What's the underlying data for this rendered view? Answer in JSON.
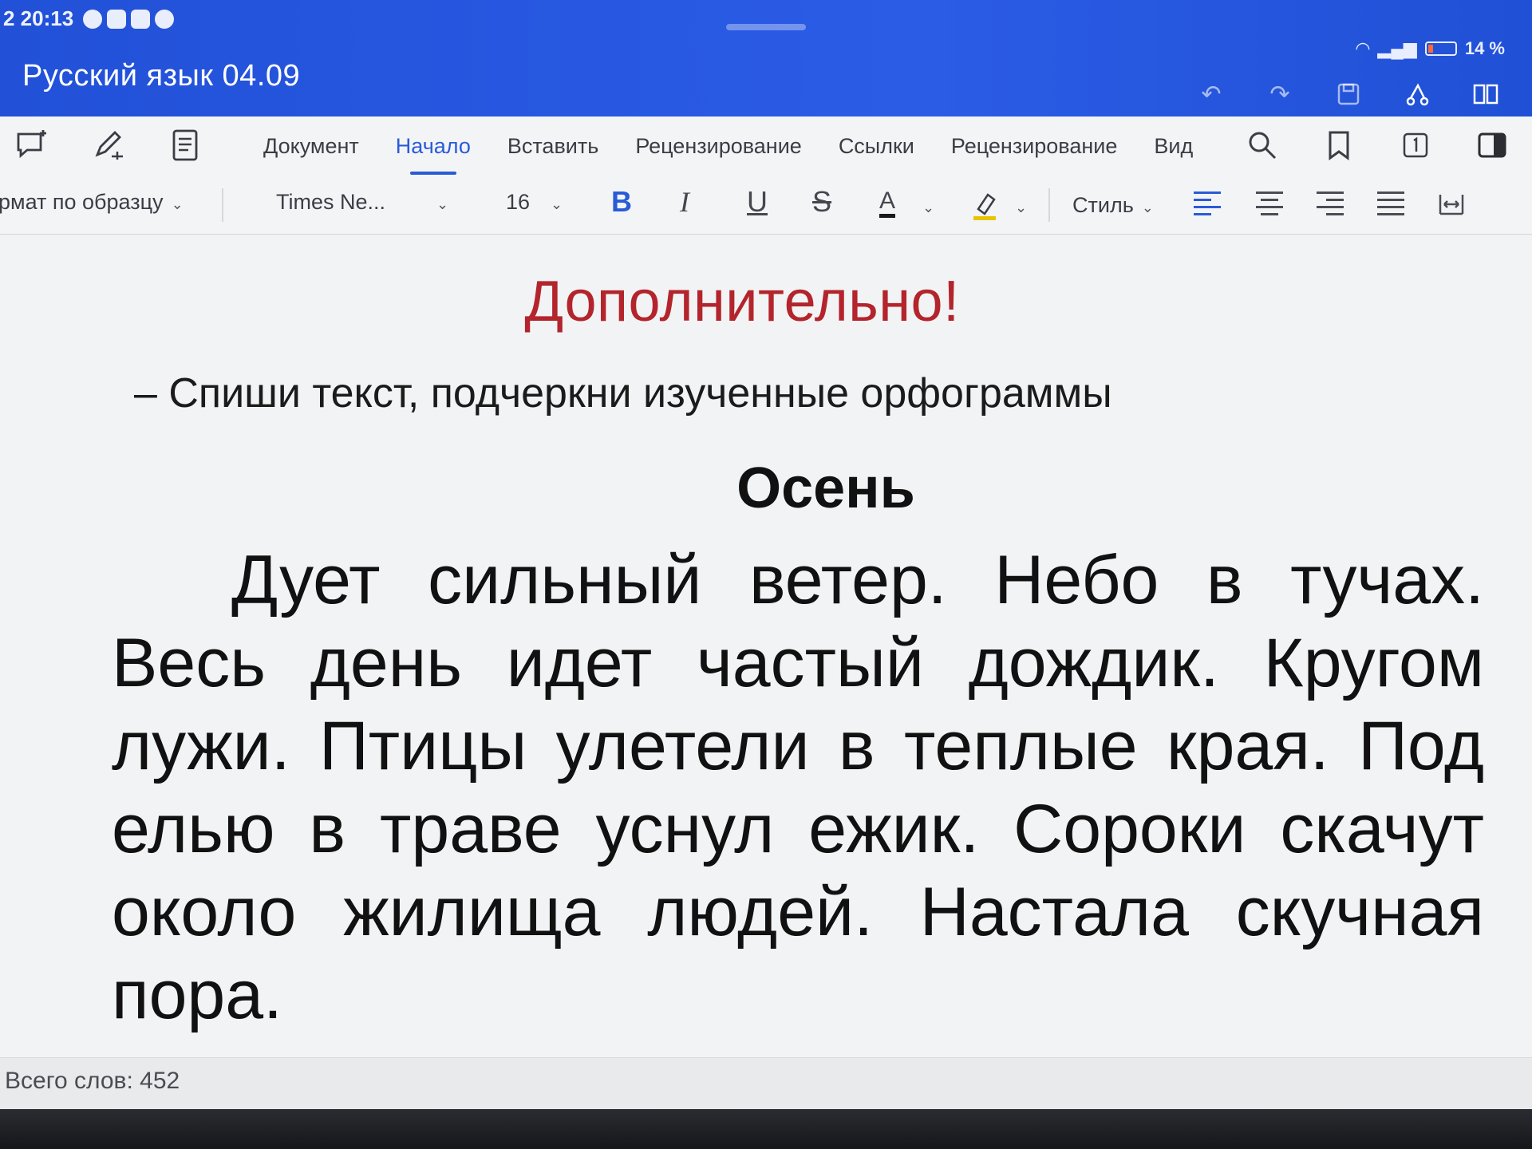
{
  "status": {
    "time": "2 20:13",
    "battery": "14 %"
  },
  "document": {
    "title": "Русский язык 04.09"
  },
  "ribbon": {
    "tabs": [
      "Документ",
      "Начало",
      "Вставить",
      "Рецензирование",
      "Ссылки",
      "Рецензирование",
      "Вид"
    ],
    "active_tab": "Начало",
    "format_painter": "рмат по образцу",
    "font_name": "Times Ne...",
    "font_size": "16",
    "bold": "B",
    "italic": "I",
    "underline": "U",
    "strike": "S",
    "font_color_letter": "A",
    "style_label": "Стиль"
  },
  "content": {
    "red_heading": "Дополнительно!",
    "instruction": "– Спиши текст, подчеркни изученные орфограммы",
    "heading": "Осень",
    "paragraph": "Дует сильный ветер. Небо в тучах. Весь день идет частый дождик. Кругом лужи. Птицы улетели в теплые края. Под елью в траве уснул ежик. Сороки скачут около жилища людей. Настала скучная пора."
  },
  "footer": {
    "word_count": "Всего слов: 452"
  },
  "colors": {
    "title_bar": "#2653dc",
    "accent": "#2a5bd7",
    "red_heading": "#b3242c"
  },
  "icons": [
    "comment-add-icon",
    "pen-icon",
    "document-icon",
    "search-icon",
    "bookmark-icon",
    "page-number-icon",
    "panel-icon",
    "undo-icon",
    "redo-icon",
    "save-icon",
    "share-icon",
    "reading-mode-icon"
  ]
}
